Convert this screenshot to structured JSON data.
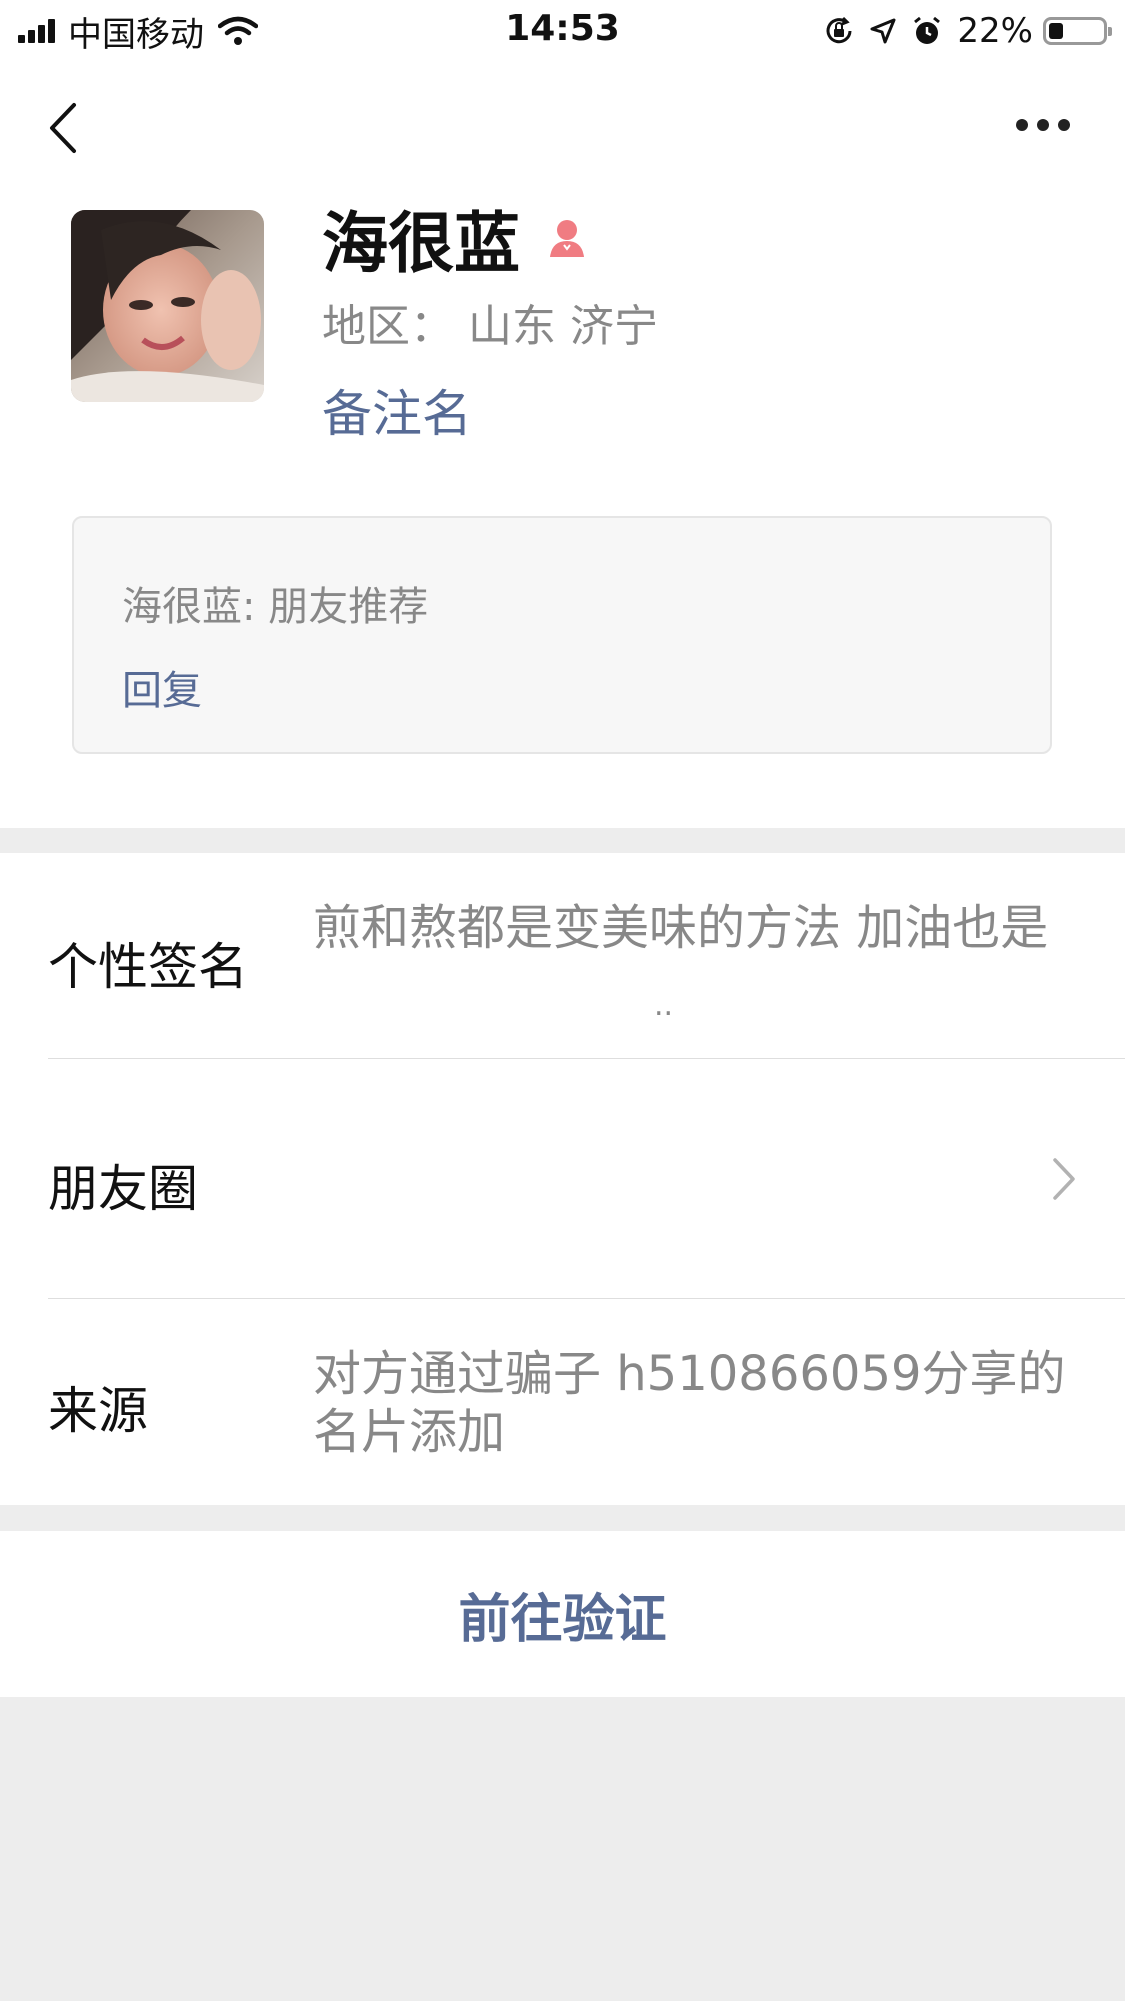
{
  "status_bar": {
    "carrier": "中国移动",
    "time": "14:53",
    "battery": "22%",
    "battery_level": 0.22,
    "icons": [
      "signal-icon",
      "wifi-icon",
      "orientation-lock-icon",
      "location-icon",
      "alarm-icon",
      "battery-icon"
    ]
  },
  "nav": {
    "back_icon": "chevron-left-icon",
    "more_icon": "more-horizontal-icon"
  },
  "profile": {
    "name": "海很蓝",
    "gender_icon": "female-icon",
    "gender_color": "#f07c82",
    "region": "地区： 山东 济宁",
    "remark": "备注名"
  },
  "message": {
    "text": "海很蓝: 朋友推荐",
    "reply": "回复"
  },
  "info": {
    "signature_label": "个性签名",
    "signature_value": "煎和熬都是变美味的方法 加油也是",
    "signature_trailing": "..",
    "moments_label": "朋友圈",
    "source_label": "来源",
    "source_value": "对方通过骗子  h510866059分享的名片添加"
  },
  "actions": {
    "verify": "前往验证"
  },
  "colors": {
    "link": "#576b95",
    "background": "#ededed"
  }
}
